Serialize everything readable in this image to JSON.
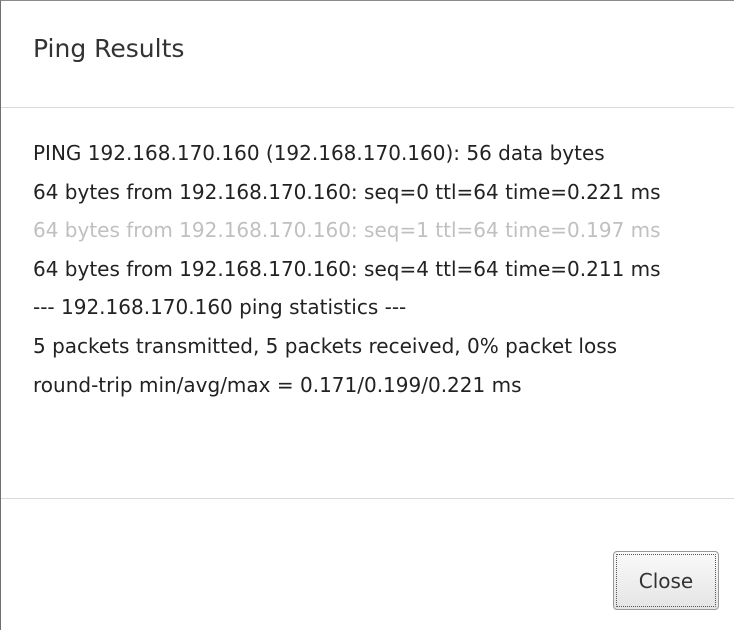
{
  "dialog": {
    "title": "Ping Results",
    "output_lines": [
      {
        "text": "PING 192.168.170.160 (192.168.170.160): 56 data bytes",
        "faded": false
      },
      {
        "text": "64 bytes from 192.168.170.160: seq=0 ttl=64 time=0.221 ms",
        "faded": false
      },
      {
        "text": "64 bytes from 192.168.170.160: seq=1 ttl=64 time=0.197 ms",
        "faded": true
      },
      {
        "text": "64 bytes from 192.168.170.160: seq=4 ttl=64 time=0.211 ms",
        "faded": false
      },
      {
        "text": "--- 192.168.170.160 ping statistics ---",
        "faded": false
      },
      {
        "text": "5 packets transmitted, 5 packets received, 0% packet loss",
        "faded": false
      },
      {
        "text": "round-trip min/avg/max = 0.171/0.199/0.221 ms",
        "faded": false
      }
    ],
    "close_label": "Close"
  }
}
